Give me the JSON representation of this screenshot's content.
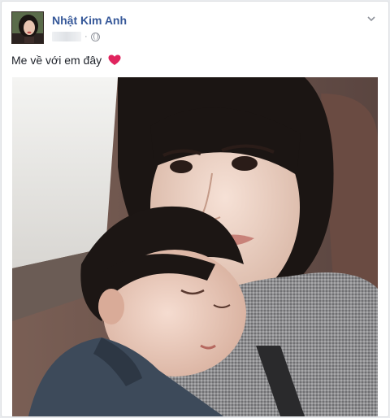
{
  "post": {
    "author_name": "Nhật Kim Anh",
    "timestamp": "",
    "privacy_icon": "globe-icon",
    "text": "Me về với em đây",
    "emoji": "heart-icon",
    "menu_icon": "chevron-down-icon"
  },
  "colors": {
    "author_link": "#365899",
    "text": "#1d2129",
    "meta": "#90949c",
    "heart": "#e0245e",
    "background": "#e9ebee"
  }
}
